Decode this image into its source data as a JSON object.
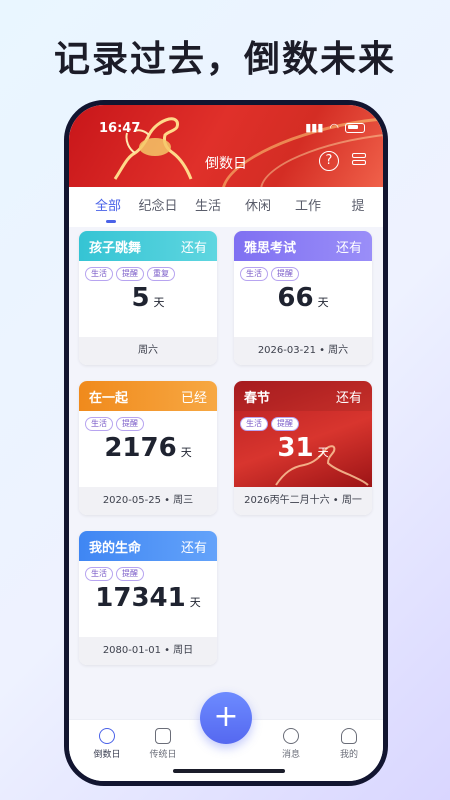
{
  "headline": "记录过去，倒数未来",
  "status": {
    "time": "16:47"
  },
  "nav": {
    "title": "倒数日"
  },
  "tabs": [
    {
      "label": "全部",
      "active": true
    },
    {
      "label": "纪念日"
    },
    {
      "label": "生活"
    },
    {
      "label": "休闲"
    },
    {
      "label": "工作"
    },
    {
      "label": "提"
    }
  ],
  "cards": [
    {
      "name": "孩子跳舞",
      "status": "还有",
      "tags": [
        "生活",
        "提醒",
        "重复"
      ],
      "days": "5",
      "unit": "天",
      "footer": "周六",
      "color": "#3cc9d6"
    },
    {
      "name": "雅思考试",
      "status": "还有",
      "tags": [
        "生活",
        "提醒"
      ],
      "days": "66",
      "unit": "天",
      "footer": "2026-03-21 • 周六",
      "color": "#8a7bf4"
    },
    {
      "name": "在一起",
      "status": "已经",
      "tags": [
        "生活",
        "提醒"
      ],
      "days": "2176",
      "unit": "天",
      "footer": "2020-05-25 • 周三",
      "color": "#f59a25"
    },
    {
      "name": "春节",
      "status": "还有",
      "tags": [
        "生活",
        "提醒"
      ],
      "days": "31",
      "unit": "天",
      "footer": "2026丙午二月十六 • 周一",
      "color": "#c93b3b"
    },
    {
      "name": "我的生命",
      "status": "还有",
      "tags": [
        "生活",
        "提醒"
      ],
      "days": "17341",
      "unit": "天",
      "footer": "2080-01-01 • 周日",
      "color": "#4d8ef5"
    }
  ],
  "bottom_nav": [
    {
      "label": "倒数日",
      "active": true
    },
    {
      "label": "传统日"
    },
    {
      "label": "消息"
    },
    {
      "label": "我的"
    }
  ],
  "fab": {
    "label": "+"
  }
}
